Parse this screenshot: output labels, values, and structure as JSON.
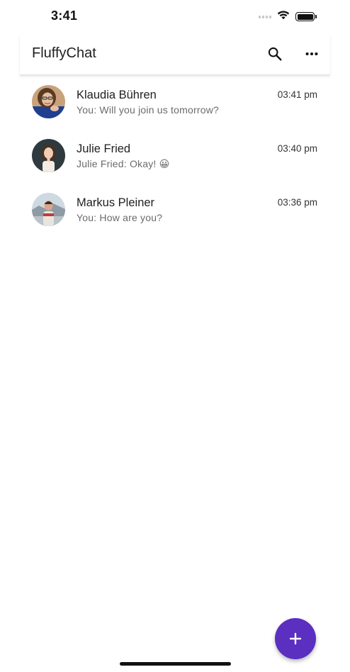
{
  "status_bar": {
    "time": "3:41"
  },
  "app_bar": {
    "title": "FluffyChat",
    "actions": [
      {
        "icon": "search-icon"
      },
      {
        "icon": "more-horizontal-icon"
      }
    ]
  },
  "chats": [
    {
      "name": "Klaudia Bühren",
      "time": "03:41 pm",
      "preview": "You: Will you join us tomorrow?",
      "avatar_icon": "avatar-klaudia"
    },
    {
      "name": "Julie Fried",
      "time": "03:40 pm",
      "preview": "Julie Fried: Okay! 😀",
      "avatar_icon": "avatar-julie"
    },
    {
      "name": "Markus Pleiner",
      "time": "03:36 pm",
      "preview": "You: How are you?",
      "avatar_icon": "avatar-markus"
    }
  ],
  "fab": {
    "icon": "plus-icon"
  },
  "colors": {
    "accent": "#5b2fc0",
    "text_primary": "#1f1f1f",
    "text_secondary": "#6b6b6b"
  }
}
